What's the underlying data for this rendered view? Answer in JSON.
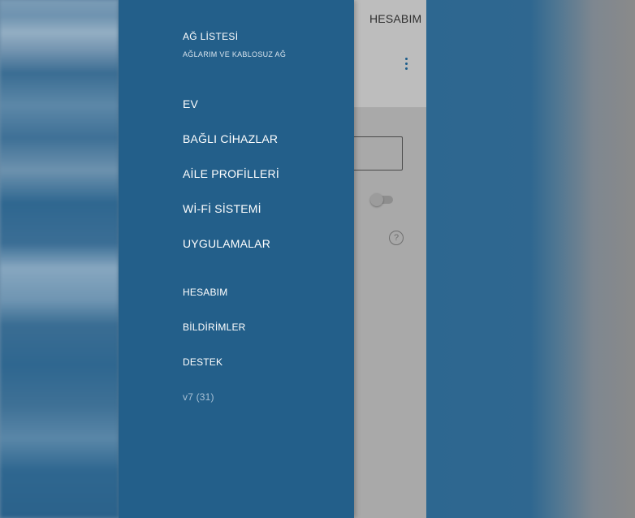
{
  "app": {
    "header_title": "HESABIM"
  },
  "drawer": {
    "network_title": "AĞ LİSTESİ",
    "network_subtitle": "AĞLARIM VE KABLOSUZ AĞ",
    "primary_items": [
      {
        "label": "EV"
      },
      {
        "label": "BAĞLI CİHAZLAR"
      },
      {
        "label": "AİLE PROFİLLERİ"
      },
      {
        "label": "Wİ-Fİ SİSTEMİ"
      },
      {
        "label": "UYGULAMALAR"
      }
    ],
    "secondary_items": [
      {
        "label": "HESABIM"
      },
      {
        "label": "BİLDİRİMLER"
      },
      {
        "label": "DESTEK"
      }
    ],
    "version": "v7 (31)"
  },
  "icons": {
    "menu": "more-vertical-icon",
    "help": "question-circle-icon",
    "help_glyph": "?"
  },
  "colors": {
    "drawer_bg": "#235f8a",
    "kebab": "#1b5c8a"
  }
}
